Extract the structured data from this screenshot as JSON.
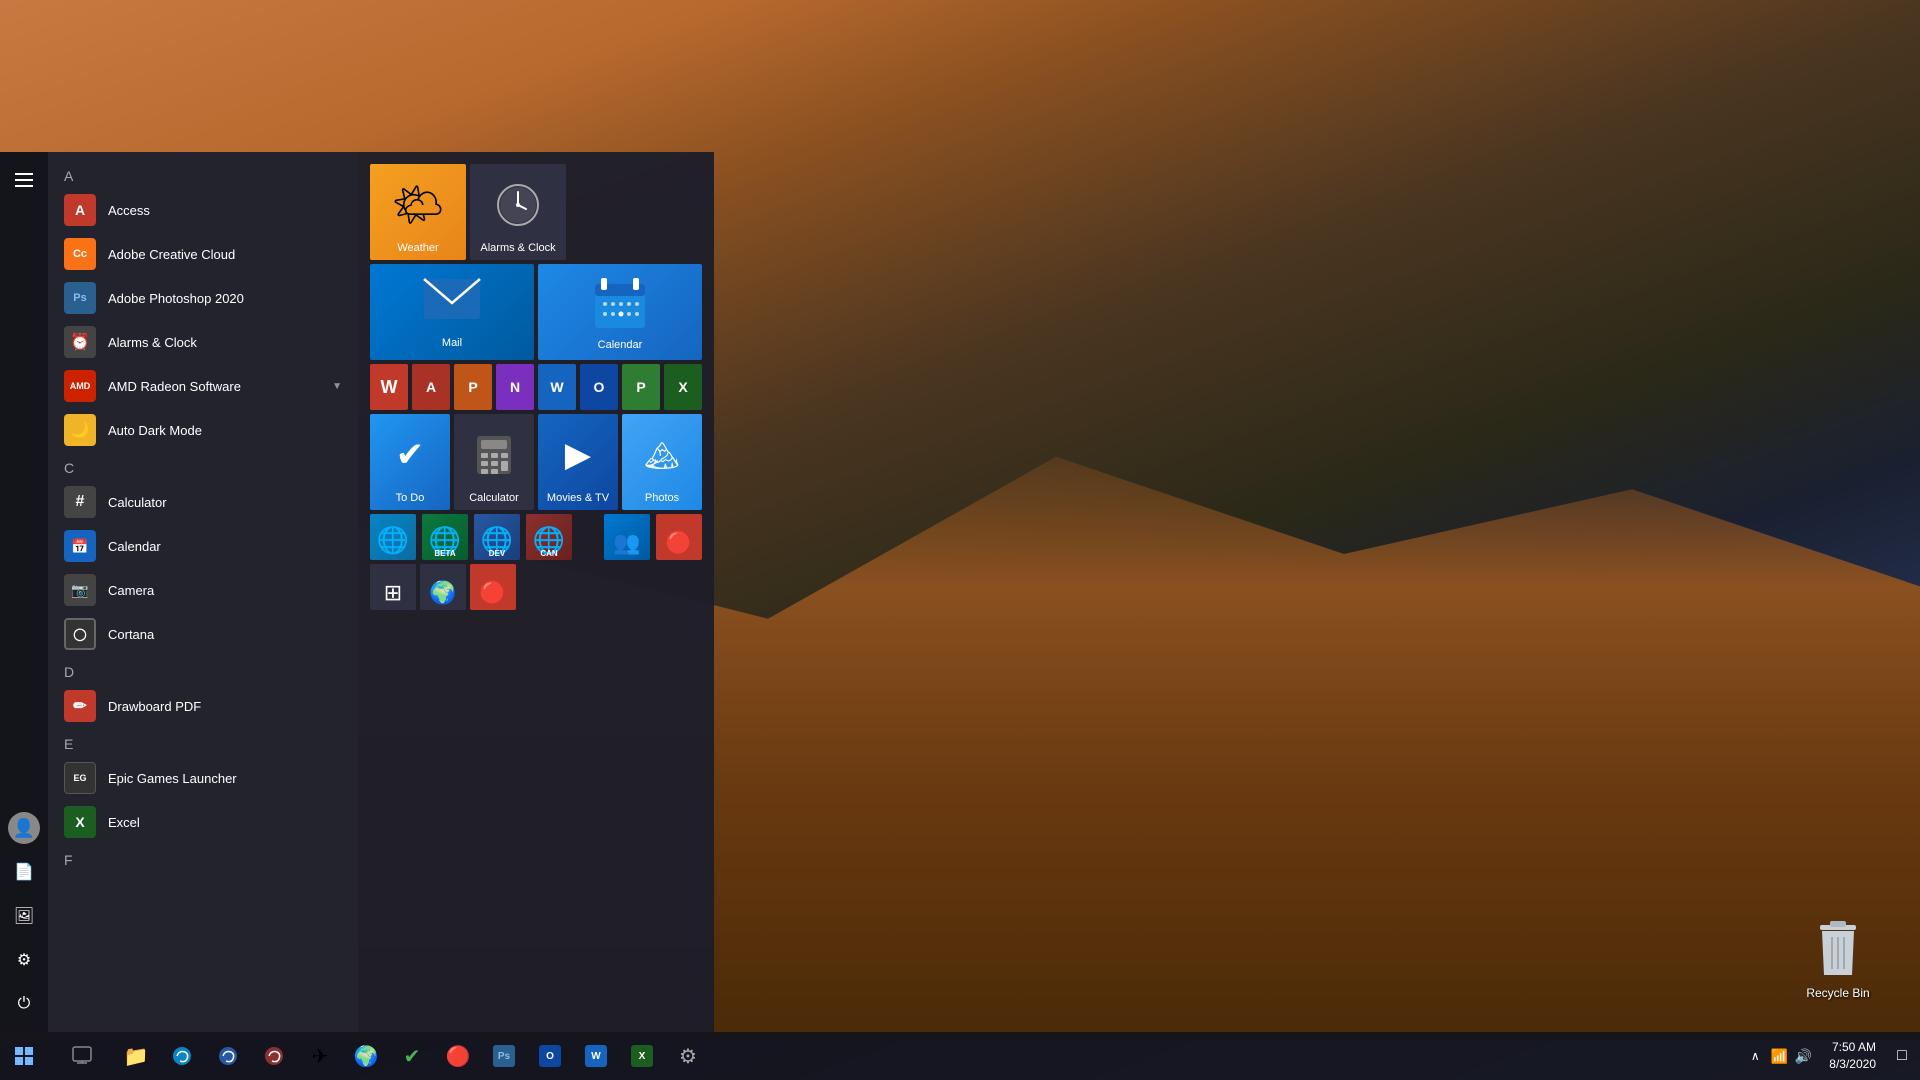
{
  "desktop": {
    "recycle_bin_label": "Recycle Bin"
  },
  "taskbar": {
    "time": "7:50 AM",
    "date": "8/3/2020",
    "apps": [
      {
        "name": "File Explorer",
        "icon": "📁"
      },
      {
        "name": "Microsoft Edge",
        "icon": "🌐"
      },
      {
        "name": "Edge Dev",
        "icon": "🌐"
      },
      {
        "name": "Edge Canary",
        "icon": "🌐"
      },
      {
        "name": "Telegram",
        "icon": "✈"
      },
      {
        "name": "App6",
        "icon": "🌍"
      },
      {
        "name": "To Do",
        "icon": "✔"
      },
      {
        "name": "App8",
        "icon": "🔴"
      },
      {
        "name": "Photoshop",
        "icon": "Ps"
      },
      {
        "name": "Outlook",
        "icon": "📧"
      },
      {
        "name": "Word",
        "icon": "W"
      },
      {
        "name": "Excel",
        "icon": "X"
      },
      {
        "name": "Settings",
        "icon": "⚙"
      }
    ]
  },
  "start_menu": {
    "sections": [
      {
        "letter": "A",
        "apps": [
          {
            "name": "Access",
            "icon": "🅰",
            "color": "#c0392b",
            "bg": "#c0392b"
          },
          {
            "name": "Adobe Creative Cloud",
            "icon": "Cc",
            "color": "#f97216",
            "bg": "#f97216"
          },
          {
            "name": "Adobe Photoshop 2020",
            "icon": "Ps",
            "color": "#2980b9",
            "bg": "#2980b9"
          },
          {
            "name": "Alarms & Clock",
            "icon": "⏰",
            "color": "#555",
            "bg": "#555",
            "expand": false
          },
          {
            "name": "AMD Radeon Software",
            "icon": "AMD",
            "color": "#e22",
            "bg": "#e22",
            "expand": true
          },
          {
            "name": "Auto Dark Mode",
            "icon": "🌙",
            "color": "#f0b429",
            "bg": "#f0b429"
          }
        ]
      },
      {
        "letter": "C",
        "apps": [
          {
            "name": "Calculator",
            "icon": "⊞",
            "color": "#555",
            "bg": "#555"
          },
          {
            "name": "Calendar",
            "icon": "📅",
            "color": "#1565c0",
            "bg": "#1565c0"
          },
          {
            "name": "Camera",
            "icon": "📷",
            "color": "#555",
            "bg": "#555"
          },
          {
            "name": "Cortana",
            "icon": "◯",
            "color": "#555",
            "bg": "#555"
          }
        ]
      },
      {
        "letter": "D",
        "apps": [
          {
            "name": "Drawboard PDF",
            "icon": "✏",
            "color": "#c0392b",
            "bg": "#c0392b"
          }
        ]
      },
      {
        "letter": "E",
        "apps": [
          {
            "name": "Epic Games Launcher",
            "icon": "EG",
            "color": "#555",
            "bg": "#333"
          },
          {
            "name": "Excel",
            "icon": "X",
            "color": "#2e7d32",
            "bg": "#2e7d32"
          }
        ]
      },
      {
        "letter": "F",
        "apps": []
      }
    ],
    "tiles": {
      "row1": [
        {
          "name": "Weather",
          "type": "weather",
          "size": "sm"
        },
        {
          "name": "Alarms & Clock",
          "type": "alarms",
          "size": "sm"
        }
      ],
      "row2": [
        {
          "name": "Mail",
          "type": "mail",
          "size": "md"
        },
        {
          "name": "Calendar",
          "type": "calendar",
          "size": "md"
        }
      ],
      "office_row": [
        {
          "name": "Office",
          "type": "office-word-red",
          "color": "#c0392b"
        },
        {
          "name": "Access",
          "type": "office-access",
          "color": "#b03020"
        },
        {
          "name": "PowerPoint",
          "type": "office-ppt",
          "color": "#c0551a"
        },
        {
          "name": "OneNote",
          "type": "office-onenote",
          "color": "#7b2fbe"
        },
        {
          "name": "Word",
          "type": "office-word",
          "color": "#1565c0"
        },
        {
          "name": "Outlook",
          "type": "office-outlook",
          "color": "#0d47a1"
        },
        {
          "name": "Publisher",
          "type": "office-pub",
          "color": "#2e7d32"
        },
        {
          "name": "Excel",
          "type": "office-excel",
          "color": "#1b5e20"
        }
      ],
      "row3": [
        {
          "name": "To Do",
          "type": "todo",
          "size": "sm"
        },
        {
          "name": "Calculator",
          "type": "calculator",
          "size": "sm"
        },
        {
          "name": "Movies & TV",
          "type": "movies",
          "size": "sm"
        },
        {
          "name": "Photos",
          "type": "photos",
          "size": "sm"
        }
      ],
      "edge_row": [
        {
          "name": "Microsoft Edge",
          "badge": "",
          "type": "edge-stable"
        },
        {
          "name": "Microsoft Edge Beta",
          "badge": "BETA",
          "type": "edge-beta"
        },
        {
          "name": "Microsoft Edge Dev",
          "badge": "DEV",
          "type": "edge-dev"
        },
        {
          "name": "Microsoft Edge Canary",
          "badge": "CAN",
          "type": "edge-can"
        }
      ],
      "people_row": [
        {
          "name": "People",
          "type": "people"
        },
        {
          "name": "Store",
          "type": "store"
        }
      ],
      "bottom_row": [
        {
          "name": "App1",
          "type": "onenote"
        },
        {
          "name": "App2",
          "type": "globe"
        },
        {
          "name": "App3",
          "type": "red-app"
        }
      ]
    }
  }
}
